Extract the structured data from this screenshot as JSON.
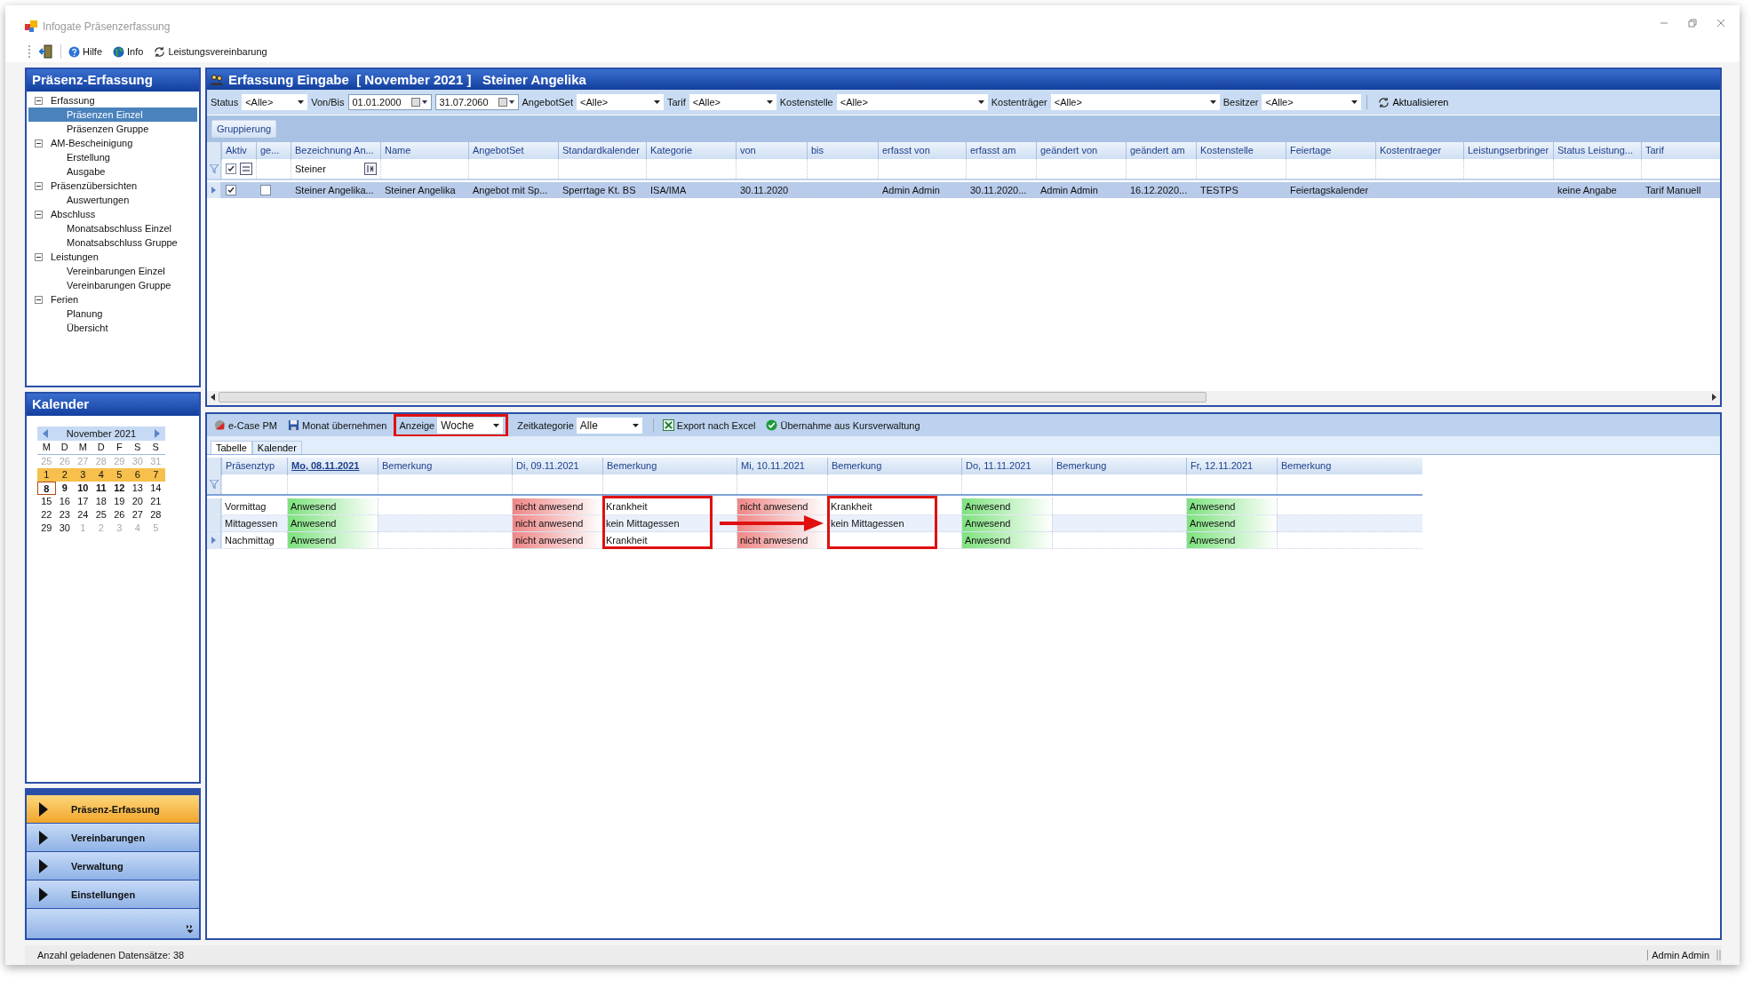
{
  "window": {
    "title": "Infogate Präsenzerfassung"
  },
  "toolbar": [
    {
      "label": "Hilfe"
    },
    {
      "label": "Info"
    },
    {
      "label": "Leistungsvereinbarung"
    }
  ],
  "sidebar": {
    "title": "Präsenz-Erfassung",
    "tree": [
      {
        "label": "Erfassung",
        "expanded": true,
        "selected": false,
        "children": [
          {
            "label": "Präsenzen Einzel",
            "selected": true
          },
          {
            "label": "Präsenzen Gruppe",
            "selected": false
          }
        ]
      },
      {
        "label": "AM-Bescheinigung",
        "expanded": true,
        "selected": false,
        "children": [
          {
            "label": "Erstellung",
            "selected": false
          },
          {
            "label": "Ausgabe",
            "selected": false
          }
        ]
      },
      {
        "label": "Präsenzübersichten",
        "expanded": true,
        "selected": false,
        "children": [
          {
            "label": "Auswertungen",
            "selected": false
          }
        ]
      },
      {
        "label": "Abschluss",
        "expanded": true,
        "selected": false,
        "children": [
          {
            "label": "Monatsabschluss Einzel",
            "selected": false
          },
          {
            "label": "Monatsabschluss Gruppe",
            "selected": false
          }
        ]
      },
      {
        "label": "Leistungen",
        "expanded": true,
        "selected": false,
        "children": [
          {
            "label": "Vereinbarungen Einzel",
            "selected": false
          },
          {
            "label": "Vereinbarungen Gruppe",
            "selected": false
          }
        ]
      },
      {
        "label": "Ferien",
        "expanded": true,
        "selected": false,
        "children": [
          {
            "label": "Planung",
            "selected": false
          },
          {
            "label": "Übersicht",
            "selected": false
          }
        ]
      }
    ]
  },
  "calendar": {
    "title": "Kalender",
    "month": "November 2021",
    "weekdays": [
      "M",
      "D",
      "M",
      "D",
      "F",
      "S",
      "S"
    ],
    "weeks": [
      [
        {
          "d": "25",
          "muted": true,
          "selected": false,
          "bold": false,
          "today": false
        },
        {
          "d": "26",
          "muted": true,
          "selected": false,
          "bold": false,
          "today": false
        },
        {
          "d": "27",
          "muted": true,
          "selected": false,
          "bold": false,
          "today": false
        },
        {
          "d": "28",
          "muted": true,
          "selected": false,
          "bold": false,
          "today": false
        },
        {
          "d": "29",
          "muted": true,
          "selected": false,
          "bold": false,
          "today": false
        },
        {
          "d": "30",
          "muted": true,
          "selected": false,
          "bold": false,
          "today": false
        },
        {
          "d": "31",
          "muted": true,
          "selected": false,
          "bold": false,
          "today": false
        }
      ],
      [
        {
          "d": "1",
          "muted": false,
          "selected": true,
          "bold": false,
          "today": false
        },
        {
          "d": "2",
          "muted": false,
          "selected": true,
          "bold": false,
          "today": false
        },
        {
          "d": "3",
          "muted": false,
          "selected": true,
          "bold": false,
          "today": false
        },
        {
          "d": "4",
          "muted": false,
          "selected": true,
          "bold": false,
          "today": false
        },
        {
          "d": "5",
          "muted": false,
          "selected": true,
          "bold": false,
          "today": false
        },
        {
          "d": "6",
          "muted": false,
          "selected": true,
          "bold": false,
          "today": false
        },
        {
          "d": "7",
          "muted": false,
          "selected": true,
          "bold": false,
          "today": false
        }
      ],
      [
        {
          "d": "8",
          "muted": false,
          "selected": false,
          "bold": true,
          "today": true
        },
        {
          "d": "9",
          "muted": false,
          "selected": false,
          "bold": true,
          "today": false
        },
        {
          "d": "10",
          "muted": false,
          "selected": false,
          "bold": true,
          "today": false
        },
        {
          "d": "11",
          "muted": false,
          "selected": false,
          "bold": true,
          "today": false
        },
        {
          "d": "12",
          "muted": false,
          "selected": false,
          "bold": true,
          "today": false
        },
        {
          "d": "13",
          "muted": false,
          "selected": false,
          "bold": false,
          "today": false
        },
        {
          "d": "14",
          "muted": false,
          "selected": false,
          "bold": false,
          "today": false
        }
      ],
      [
        {
          "d": "15",
          "muted": false,
          "selected": false,
          "bold": false,
          "today": false
        },
        {
          "d": "16",
          "muted": false,
          "selected": false,
          "bold": false,
          "today": false
        },
        {
          "d": "17",
          "muted": false,
          "selected": false,
          "bold": false,
          "today": false
        },
        {
          "d": "18",
          "muted": false,
          "selected": false,
          "bold": false,
          "today": false
        },
        {
          "d": "19",
          "muted": false,
          "selected": false,
          "bold": false,
          "today": false
        },
        {
          "d": "20",
          "muted": false,
          "selected": false,
          "bold": false,
          "today": false
        },
        {
          "d": "21",
          "muted": false,
          "selected": false,
          "bold": false,
          "today": false
        }
      ],
      [
        {
          "d": "22",
          "muted": false,
          "selected": false,
          "bold": false,
          "today": false
        },
        {
          "d": "23",
          "muted": false,
          "selected": false,
          "bold": false,
          "today": false
        },
        {
          "d": "24",
          "muted": false,
          "selected": false,
          "bold": false,
          "today": false
        },
        {
          "d": "25",
          "muted": false,
          "selected": false,
          "bold": false,
          "today": false
        },
        {
          "d": "26",
          "muted": false,
          "selected": false,
          "bold": false,
          "today": false
        },
        {
          "d": "27",
          "muted": false,
          "selected": false,
          "bold": false,
          "today": false
        },
        {
          "d": "28",
          "muted": false,
          "selected": false,
          "bold": false,
          "today": false
        }
      ],
      [
        {
          "d": "29",
          "muted": false,
          "selected": false,
          "bold": false,
          "today": false
        },
        {
          "d": "30",
          "muted": false,
          "selected": false,
          "bold": false,
          "today": false
        },
        {
          "d": "1",
          "muted": true,
          "selected": false,
          "bold": false,
          "today": false
        },
        {
          "d": "2",
          "muted": true,
          "selected": false,
          "bold": false,
          "today": false
        },
        {
          "d": "3",
          "muted": true,
          "selected": false,
          "bold": false,
          "today": false
        },
        {
          "d": "4",
          "muted": true,
          "selected": false,
          "bold": false,
          "today": false
        },
        {
          "d": "5",
          "muted": true,
          "selected": false,
          "bold": false,
          "today": false
        }
      ]
    ]
  },
  "nav": [
    {
      "label": "Präsenz-Erfassung",
      "selected": true
    },
    {
      "label": "Vereinbarungen",
      "selected": false
    },
    {
      "label": "Verwaltung",
      "selected": false
    },
    {
      "label": "Einstellungen",
      "selected": false
    }
  ],
  "main": {
    "title": "Erfassung Eingabe  [ November 2021 ]   Steiner Angelika"
  },
  "filters": [
    {
      "kind": "combo",
      "label": "Status",
      "value": "<Alle>"
    },
    {
      "kind": "daterange",
      "label": "Von/Bis",
      "values": [
        "01.01.2000",
        "31.07.2060"
      ]
    },
    {
      "kind": "combo",
      "label": "AngebotSet",
      "value": "<Alle>"
    },
    {
      "kind": "combo",
      "label": "Tarif",
      "value": "<Alle>"
    },
    {
      "kind": "combo",
      "label": "Kostenstelle",
      "value": "<Alle>"
    },
    {
      "kind": "combo",
      "label": "Kostenträger",
      "value": "<Alle>"
    },
    {
      "kind": "combo",
      "label": "Besitzer",
      "value": "<Alle>"
    },
    {
      "kind": "button",
      "label": "Aktualisieren"
    }
  ],
  "grouping_button": "Gruppierung",
  "upper_grid": {
    "columns": [
      "Aktiv",
      "ge...",
      "Bezeichnung An...",
      "Name",
      "AngebotSet",
      "Standardkalender",
      "Kategorie",
      "von",
      "bis",
      "erfasst von",
      "erfasst am",
      "geändert von",
      "geändert am",
      "Kostenstelle",
      "Feiertage",
      "Kostentraeger",
      "Leistungserbringer",
      "Status Leistung...",
      "Tarif"
    ],
    "filter_row": [
      {
        "kind": "checkop",
        "checked": true
      },
      {
        "kind": "empty"
      },
      {
        "kind": "textop",
        "text": "Steiner"
      },
      {
        "kind": "empty"
      },
      {
        "kind": "empty"
      },
      {
        "kind": "empty"
      },
      {
        "kind": "empty"
      },
      {
        "kind": "empty"
      },
      {
        "kind": "empty"
      },
      {
        "kind": "empty"
      },
      {
        "kind": "empty"
      },
      {
        "kind": "empty"
      },
      {
        "kind": "empty"
      },
      {
        "kind": "empty"
      },
      {
        "kind": "empty"
      },
      {
        "kind": "empty"
      },
      {
        "kind": "empty"
      },
      {
        "kind": "empty"
      },
      {
        "kind": "empty"
      }
    ],
    "rows": [
      {
        "selected": true,
        "cells": [
          {
            "kind": "check",
            "checked": true
          },
          {
            "kind": "check",
            "checked": false
          },
          {
            "kind": "text",
            "text": "Steiner Angelika..."
          },
          {
            "kind": "text",
            "text": "Steiner Angelika"
          },
          {
            "kind": "text",
            "text": "Angebot mit Sp..."
          },
          {
            "kind": "text",
            "text": "Sperrtage Kt. BS"
          },
          {
            "kind": "text",
            "text": "ISA/IMA"
          },
          {
            "kind": "text",
            "text": "30.11.2020"
          },
          {
            "kind": "empty"
          },
          {
            "kind": "text",
            "text": "Admin Admin"
          },
          {
            "kind": "text",
            "text": "30.11.2020..."
          },
          {
            "kind": "text",
            "text": "Admin Admin"
          },
          {
            "kind": "text",
            "text": "16.12.2020..."
          },
          {
            "kind": "text",
            "text": "TESTPS"
          },
          {
            "kind": "text",
            "text": "Feiertagskalender"
          },
          {
            "kind": "empty"
          },
          {
            "kind": "empty"
          },
          {
            "kind": "text",
            "text": "keine Angabe"
          },
          {
            "kind": "text",
            "text": "Tarif Manuell"
          }
        ]
      }
    ]
  },
  "lower_toolbar": [
    {
      "kind": "button",
      "label": "e-Case PM"
    },
    {
      "kind": "button",
      "label": "Monat übernehmen"
    },
    {
      "kind": "combo",
      "label": "Anzeige",
      "value": "Woche",
      "highlighted": true
    },
    {
      "kind": "combo",
      "label": "Zeitkategorie",
      "value": "Alle",
      "highlighted": false
    },
    {
      "kind": "button",
      "label": "Export nach Excel"
    },
    {
      "kind": "button",
      "label": "Übernahme aus Kursverwaltung"
    }
  ],
  "tabs": [
    {
      "label": "Tabelle",
      "selected": true
    },
    {
      "label": "Kalender",
      "selected": false
    }
  ],
  "lower_grid": {
    "columns": [
      {
        "kind": "type",
        "label": "Präsenztyp",
        "focused": false,
        "highlighted": false
      },
      {
        "kind": "day",
        "label": "Mo, 08.11.2021",
        "focused": true,
        "highlighted": false
      },
      {
        "kind": "remark",
        "label": "Bemerkung",
        "focused": false,
        "highlighted": false
      },
      {
        "kind": "day",
        "label": "Di, 09.11.2021",
        "focused": false,
        "highlighted": false
      },
      {
        "kind": "remark",
        "label": "Bemerkung",
        "focused": false,
        "highlighted": true
      },
      {
        "kind": "day",
        "label": "Mi, 10.11.2021",
        "focused": false,
        "highlighted": false
      },
      {
        "kind": "remark",
        "label": "Bemerkung",
        "focused": false,
        "highlighted": true
      },
      {
        "kind": "day",
        "label": "Do, 11.11.2021",
        "focused": false,
        "highlighted": false
      },
      {
        "kind": "remark",
        "label": "Bemerkung",
        "focused": false,
        "highlighted": false
      },
      {
        "kind": "day",
        "label": "Fr, 12.11.2021",
        "focused": false,
        "highlighted": false
      },
      {
        "kind": "remark",
        "label": "Bemerkung",
        "focused": false,
        "highlighted": false
      }
    ],
    "rows": [
      {
        "type": "Vormittag",
        "current": false,
        "days": [
          {
            "present": true,
            "text": "Anwesend"
          },
          {
            "present": false,
            "text": "nicht anwesend",
            "remark": "Krankheit"
          },
          {
            "present": false,
            "text": "nicht anwesend",
            "remark": "Krankheit"
          },
          {
            "present": true,
            "text": "Anwesend"
          },
          {
            "present": true,
            "text": "Anwesend"
          }
        ]
      },
      {
        "type": "Mittagessen",
        "current": false,
        "days": [
          {
            "present": true,
            "text": "Anwesend"
          },
          {
            "present": false,
            "text": "nicht anwesend",
            "remark": "kein Mittagessen"
          },
          {
            "present": false,
            "remark": "kein Mittagessen"
          },
          {
            "present": true,
            "text": "Anwesend"
          },
          {
            "present": true,
            "text": "Anwesend"
          }
        ]
      },
      {
        "type": "Nachmittag",
        "current": true,
        "days": [
          {
            "present": true,
            "text": "Anwesend"
          },
          {
            "present": false,
            "text": "nicht anwesend",
            "remark": "Krankheit"
          },
          {
            "present": false,
            "text": "nicht anwesend"
          },
          {
            "present": true,
            "text": "Anwesend"
          },
          {
            "present": true,
            "text": "Anwesend"
          }
        ]
      }
    ]
  },
  "status_bar": {
    "left": "Anzahl geladenen Datensätze: 38",
    "right": "Admin Admin"
  }
}
